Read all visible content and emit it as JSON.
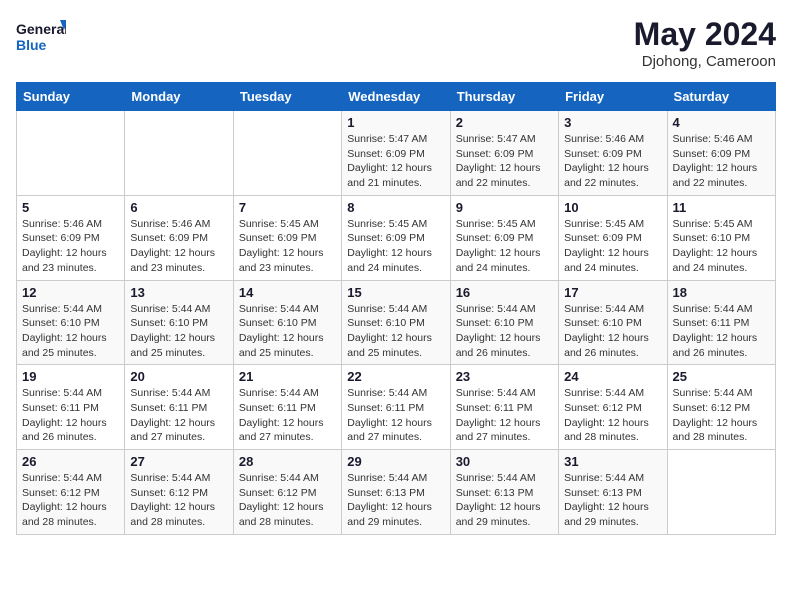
{
  "header": {
    "logo_line1": "General",
    "logo_line2": "Blue",
    "title": "May 2024",
    "subtitle": "Djohong, Cameroon"
  },
  "weekdays": [
    "Sunday",
    "Monday",
    "Tuesday",
    "Wednesday",
    "Thursday",
    "Friday",
    "Saturday"
  ],
  "weeks": [
    [
      {
        "day": "",
        "info": ""
      },
      {
        "day": "",
        "info": ""
      },
      {
        "day": "",
        "info": ""
      },
      {
        "day": "1",
        "info": "Sunrise: 5:47 AM\nSunset: 6:09 PM\nDaylight: 12 hours and 21 minutes."
      },
      {
        "day": "2",
        "info": "Sunrise: 5:47 AM\nSunset: 6:09 PM\nDaylight: 12 hours and 22 minutes."
      },
      {
        "day": "3",
        "info": "Sunrise: 5:46 AM\nSunset: 6:09 PM\nDaylight: 12 hours and 22 minutes."
      },
      {
        "day": "4",
        "info": "Sunrise: 5:46 AM\nSunset: 6:09 PM\nDaylight: 12 hours and 22 minutes."
      }
    ],
    [
      {
        "day": "5",
        "info": "Sunrise: 5:46 AM\nSunset: 6:09 PM\nDaylight: 12 hours and 23 minutes."
      },
      {
        "day": "6",
        "info": "Sunrise: 5:46 AM\nSunset: 6:09 PM\nDaylight: 12 hours and 23 minutes."
      },
      {
        "day": "7",
        "info": "Sunrise: 5:45 AM\nSunset: 6:09 PM\nDaylight: 12 hours and 23 minutes."
      },
      {
        "day": "8",
        "info": "Sunrise: 5:45 AM\nSunset: 6:09 PM\nDaylight: 12 hours and 24 minutes."
      },
      {
        "day": "9",
        "info": "Sunrise: 5:45 AM\nSunset: 6:09 PM\nDaylight: 12 hours and 24 minutes."
      },
      {
        "day": "10",
        "info": "Sunrise: 5:45 AM\nSunset: 6:09 PM\nDaylight: 12 hours and 24 minutes."
      },
      {
        "day": "11",
        "info": "Sunrise: 5:45 AM\nSunset: 6:10 PM\nDaylight: 12 hours and 24 minutes."
      }
    ],
    [
      {
        "day": "12",
        "info": "Sunrise: 5:44 AM\nSunset: 6:10 PM\nDaylight: 12 hours and 25 minutes."
      },
      {
        "day": "13",
        "info": "Sunrise: 5:44 AM\nSunset: 6:10 PM\nDaylight: 12 hours and 25 minutes."
      },
      {
        "day": "14",
        "info": "Sunrise: 5:44 AM\nSunset: 6:10 PM\nDaylight: 12 hours and 25 minutes."
      },
      {
        "day": "15",
        "info": "Sunrise: 5:44 AM\nSunset: 6:10 PM\nDaylight: 12 hours and 25 minutes."
      },
      {
        "day": "16",
        "info": "Sunrise: 5:44 AM\nSunset: 6:10 PM\nDaylight: 12 hours and 26 minutes."
      },
      {
        "day": "17",
        "info": "Sunrise: 5:44 AM\nSunset: 6:10 PM\nDaylight: 12 hours and 26 minutes."
      },
      {
        "day": "18",
        "info": "Sunrise: 5:44 AM\nSunset: 6:11 PM\nDaylight: 12 hours and 26 minutes."
      }
    ],
    [
      {
        "day": "19",
        "info": "Sunrise: 5:44 AM\nSunset: 6:11 PM\nDaylight: 12 hours and 26 minutes."
      },
      {
        "day": "20",
        "info": "Sunrise: 5:44 AM\nSunset: 6:11 PM\nDaylight: 12 hours and 27 minutes."
      },
      {
        "day": "21",
        "info": "Sunrise: 5:44 AM\nSunset: 6:11 PM\nDaylight: 12 hours and 27 minutes."
      },
      {
        "day": "22",
        "info": "Sunrise: 5:44 AM\nSunset: 6:11 PM\nDaylight: 12 hours and 27 minutes."
      },
      {
        "day": "23",
        "info": "Sunrise: 5:44 AM\nSunset: 6:11 PM\nDaylight: 12 hours and 27 minutes."
      },
      {
        "day": "24",
        "info": "Sunrise: 5:44 AM\nSunset: 6:12 PM\nDaylight: 12 hours and 28 minutes."
      },
      {
        "day": "25",
        "info": "Sunrise: 5:44 AM\nSunset: 6:12 PM\nDaylight: 12 hours and 28 minutes."
      }
    ],
    [
      {
        "day": "26",
        "info": "Sunrise: 5:44 AM\nSunset: 6:12 PM\nDaylight: 12 hours and 28 minutes."
      },
      {
        "day": "27",
        "info": "Sunrise: 5:44 AM\nSunset: 6:12 PM\nDaylight: 12 hours and 28 minutes."
      },
      {
        "day": "28",
        "info": "Sunrise: 5:44 AM\nSunset: 6:12 PM\nDaylight: 12 hours and 28 minutes."
      },
      {
        "day": "29",
        "info": "Sunrise: 5:44 AM\nSunset: 6:13 PM\nDaylight: 12 hours and 29 minutes."
      },
      {
        "day": "30",
        "info": "Sunrise: 5:44 AM\nSunset: 6:13 PM\nDaylight: 12 hours and 29 minutes."
      },
      {
        "day": "31",
        "info": "Sunrise: 5:44 AM\nSunset: 6:13 PM\nDaylight: 12 hours and 29 minutes."
      },
      {
        "day": "",
        "info": ""
      }
    ]
  ]
}
